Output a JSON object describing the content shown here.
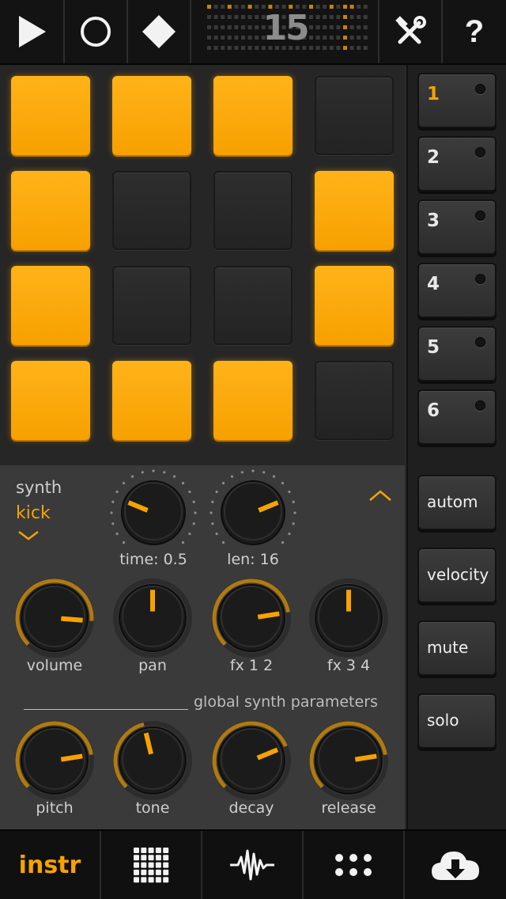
{
  "top_bar": {
    "play": "play-icon",
    "record": "record-icon",
    "stop": "diamond-icon",
    "step_number": "15",
    "tools": "tools-icon",
    "help_label": "?"
  },
  "pads": [
    [
      true,
      true,
      true,
      false
    ],
    [
      true,
      false,
      false,
      true
    ],
    [
      true,
      false,
      false,
      true
    ],
    [
      true,
      true,
      true,
      false
    ]
  ],
  "sequences": [
    {
      "label": "1",
      "active": true
    },
    {
      "label": "2",
      "active": false
    },
    {
      "label": "3",
      "active": false
    },
    {
      "label": "4",
      "active": false
    },
    {
      "label": "5",
      "active": false
    },
    {
      "label": "6",
      "active": false
    }
  ],
  "side_buttons": {
    "autom": "autom",
    "velocity": "velocity",
    "mute": "mute",
    "solo": "solo"
  },
  "instrument": {
    "category": "synth",
    "name": "kick"
  },
  "knobs": {
    "time": {
      "label": "time: 0.5",
      "value": 0.25
    },
    "len": {
      "label": "len: 16",
      "value": 0.75
    },
    "volume": {
      "label": "volume",
      "value": 0.85
    },
    "pan": {
      "label": "pan",
      "value": 0.5
    },
    "fx12": {
      "label": "fx 1 2",
      "value": 0.8
    },
    "fx34": {
      "label": "fx 3 4",
      "value": 0.5
    },
    "pitch": {
      "label": "pitch",
      "value": 0.8
    },
    "tone": {
      "label": "tone",
      "value": 0.45
    },
    "decay": {
      "label": "decay",
      "value": 0.75
    },
    "release": {
      "label": "release",
      "value": 0.8
    }
  },
  "section_label": "global synth parameters",
  "bottom_bar": {
    "instr_label": "instr",
    "grid": "grid-icon",
    "wave": "waveform-icon",
    "dots": "dots-icon",
    "download": "cloud-download-icon"
  },
  "colors": {
    "accent": "#f6a300",
    "pad_off": "#2a2a2a",
    "panel": "#3a3a3a"
  }
}
